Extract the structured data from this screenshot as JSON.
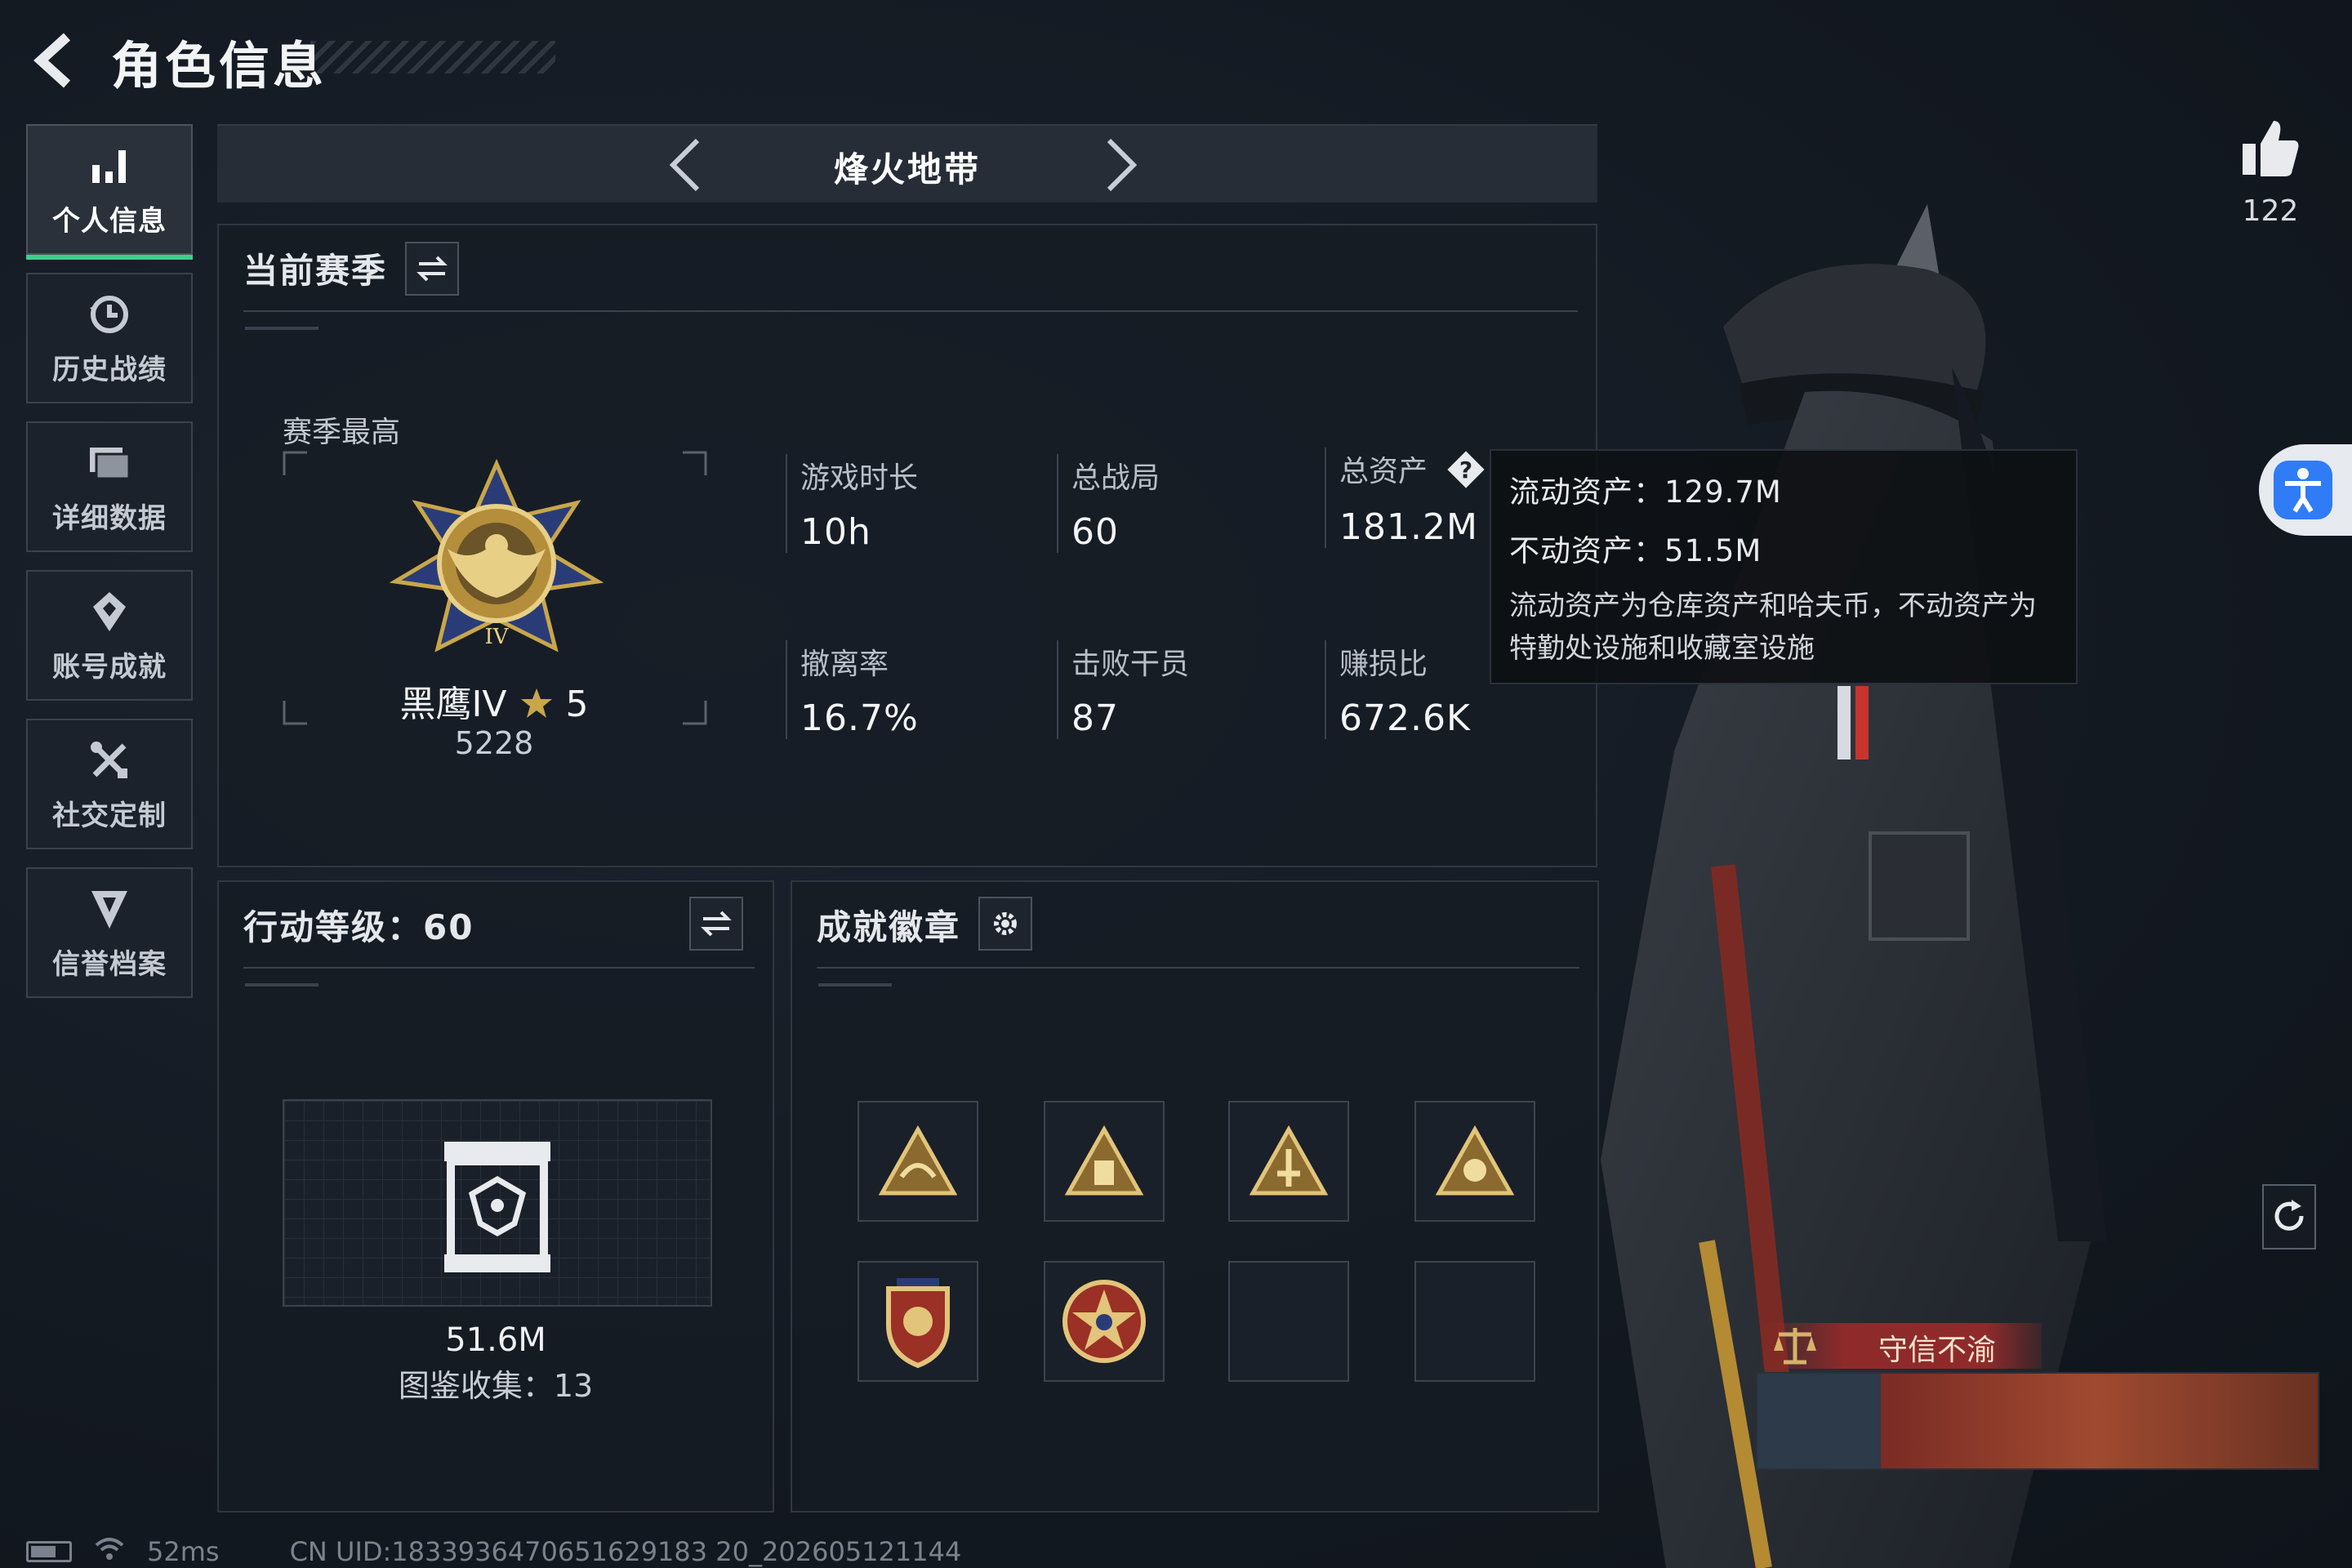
{
  "header": {
    "title": "角色信息"
  },
  "sidebar": {
    "items": [
      {
        "label": "个人信息",
        "icon": "bar-chart-icon",
        "active": true
      },
      {
        "label": "历史战绩",
        "icon": "history-icon",
        "active": false
      },
      {
        "label": "详细数据",
        "icon": "folder-icon",
        "active": false
      },
      {
        "label": "账号成就",
        "icon": "achievement-icon",
        "active": false
      },
      {
        "label": "社交定制",
        "icon": "tools-icon",
        "active": false
      },
      {
        "label": "信誉档案",
        "icon": "shield-icon",
        "active": false
      }
    ]
  },
  "mode": {
    "title": "烽火地带"
  },
  "season": {
    "head": "当前赛季",
    "best_label": "赛季最高",
    "rank_name": "黑鹰IV",
    "rank_stars": "5",
    "rank_score": "5228",
    "stats": [
      {
        "label": "游戏时长",
        "value": "10h"
      },
      {
        "label": "总战局",
        "value": "60"
      },
      {
        "label": "总资产",
        "value": "181.2M"
      },
      {
        "label": "撤离率",
        "value": "16.7%"
      },
      {
        "label": "击败干员",
        "value": "87"
      },
      {
        "label": "赚损比",
        "value": "672.6K"
      }
    ]
  },
  "tooltip": {
    "liquid": "流动资产：129.7M",
    "fixed": "不动资产：51.5M",
    "desc": "流动资产为仓库资产和哈夫币，不动资产为特勤处设施和收藏室设施"
  },
  "level": {
    "head": "行动等级：60",
    "value": "51.6M",
    "collect": "图鉴收集：13"
  },
  "badges": {
    "head": "成就徽章",
    "slots": [
      {
        "filled": true
      },
      {
        "filled": true
      },
      {
        "filled": true
      },
      {
        "filled": true
      },
      {
        "filled": true
      },
      {
        "filled": true
      },
      {
        "filled": false
      },
      {
        "filled": false
      }
    ]
  },
  "social": {
    "like_count": "122",
    "honor_title": "守信不渝"
  },
  "footer": {
    "ping": "52ms",
    "uid": "CN UID:1833936470651629183 20_202605121144"
  },
  "colors": {
    "accent_green": "#3ccf8e",
    "gold": "#c8a64a",
    "honor_red": "#8f2a2a",
    "access_blue": "#2f7cf6"
  }
}
